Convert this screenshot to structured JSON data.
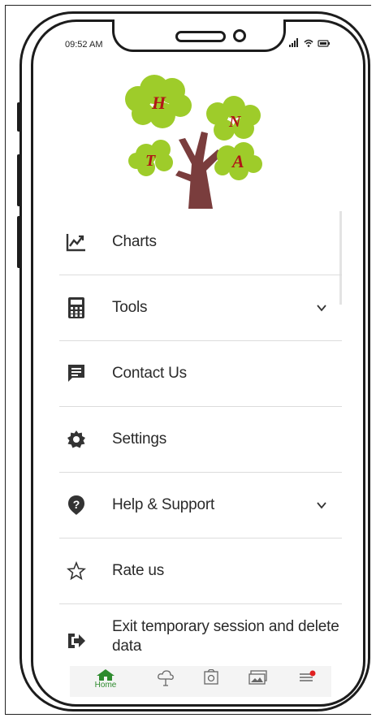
{
  "status_bar": {
    "time": "09:52 AM"
  },
  "logo": {
    "letters": [
      "H",
      "N",
      "T",
      "A"
    ]
  },
  "menu": {
    "items": [
      {
        "label": "Charts",
        "icon": "chart-icon"
      },
      {
        "label": "Tools",
        "icon": "calculator-icon",
        "expandable": true
      },
      {
        "label": "Contact Us",
        "icon": "message-icon"
      },
      {
        "label": "Settings",
        "icon": "gear-icon"
      },
      {
        "label": "Help & Support",
        "icon": "help-icon",
        "expandable": true
      },
      {
        "label": "Rate us",
        "icon": "star-icon"
      },
      {
        "label_line1": "Exit temporary session and delete",
        "label_line2": "data",
        "icon": "exit-icon"
      }
    ]
  },
  "bottom_nav": {
    "home_label": "Home",
    "items": [
      "home-icon",
      "cloud-icon",
      "camera-icon",
      "gallery-icon",
      "menu-icon"
    ]
  },
  "colors": {
    "accent_green": "#2e8b2e",
    "tree_green": "#9ecc2a",
    "trunk": "#7a3d3d",
    "letter_red": "#b01717",
    "notification_red": "#e02020"
  }
}
